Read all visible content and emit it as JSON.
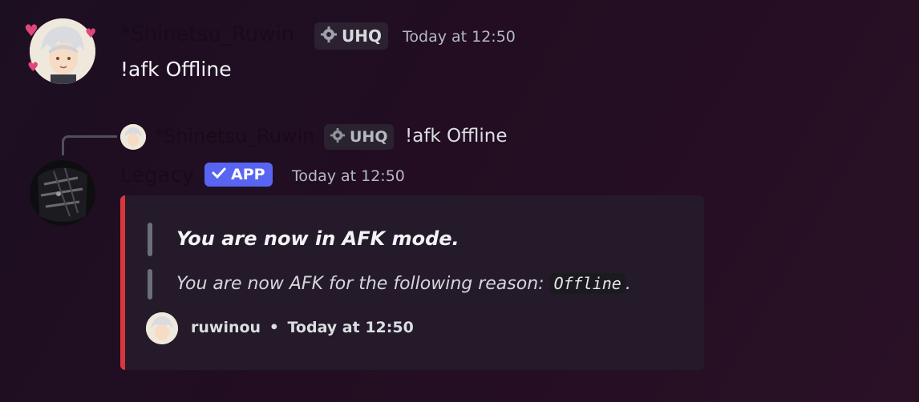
{
  "message1": {
    "username": "*Shinetsu_Ruwin",
    "tag": "UHQ",
    "tag_icon": "gear-badge-icon",
    "timestamp": "Today at 12:50",
    "content": "!afk Offline"
  },
  "reply": {
    "username": "*Shinetsu_Ruwin",
    "tag": "UHQ",
    "content": "!afk Offline"
  },
  "message2": {
    "username": "Legacy",
    "app_badge": "APP",
    "timestamp": "Today at 12:50",
    "embed": {
      "accent_color": "#da373c",
      "title": "You are now in AFK mode.",
      "description_prefix": "You are now AFK for the following reason: ",
      "reason": "Offline",
      "description_suffix": ".",
      "footer_user": "ruwinou",
      "footer_separator": "•",
      "footer_time": "Today at 12:50"
    }
  },
  "colors": {
    "app_badge": "#5865f2",
    "embed_bg": "#241a2a"
  }
}
